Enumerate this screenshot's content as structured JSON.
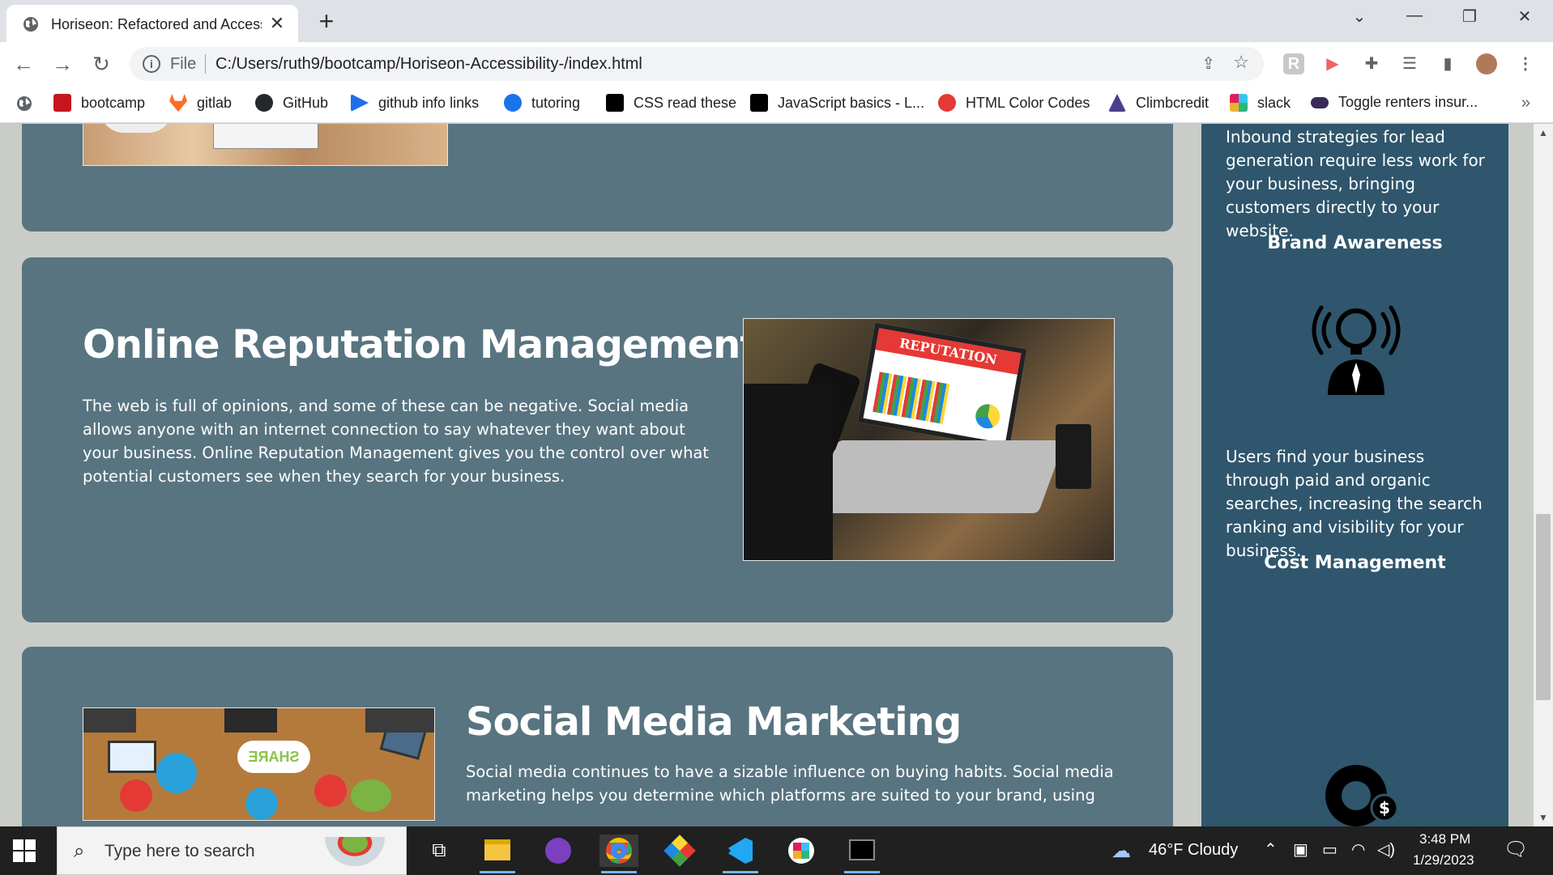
{
  "browser": {
    "tab_title": "Horiseon: Refactored and Accessible",
    "url_scheme": "File",
    "url": "C:/Users/ruth9/bootcamp/Horiseon-Accessibility-/index.html",
    "bookmarks": [
      {
        "label": "bootcamp",
        "color": "#c4161c"
      },
      {
        "label": "gitlab",
        "color": "#fc6d26"
      },
      {
        "label": "GitHub",
        "color": "#24292e"
      },
      {
        "label": "github info links",
        "color": "#1f6feb"
      },
      {
        "label": "tutoring",
        "color": "#1a73e8"
      },
      {
        "label": "CSS read these",
        "color": "#000000"
      },
      {
        "label": "JavaScript basics - L...",
        "color": "#000000"
      },
      {
        "label": "HTML Color Codes",
        "color": "#e53935"
      },
      {
        "label": "Climbcredit",
        "color": "#4a3f8a"
      },
      {
        "label": "slack",
        "color": "#36c5f0"
      },
      {
        "label": "Toggle renters insur...",
        "color": "#3a2a5a"
      }
    ]
  },
  "page": {
    "top_card_image_alt": "notebook on wooden desk",
    "reputation": {
      "heading": "Online Reputation Management",
      "body": "The web is full of opinions, and some of these can be negative. Social media allows anyone with an internet connection to say whatever they want about your business. Online Reputation Management gives you the control over what potential customers see when they search for your business.",
      "image_text": "REPUTATION"
    },
    "social": {
      "heading": "Social Media Marketing",
      "body": "Social media continues to have a sizable influence on buying habits. Social media marketing helps you determine which platforms are suited to your brand, using",
      "image_text": "SHARE"
    },
    "aside": {
      "lead_text": "Inbound strategies for lead generation require less work for your business, bringing customers directly to your website.",
      "brand_heading": "Brand Awareness",
      "brand_text": "Users find your business through paid and organic searches, increasing the search ranking and visibility for your business.",
      "cost_heading": "Cost Management"
    }
  },
  "taskbar": {
    "search_placeholder": "Type here to search",
    "weather": "46°F  Cloudy",
    "time": "3:48 PM",
    "date": "1/29/2023"
  },
  "colors": {
    "card": "#587480",
    "aside": "#2f566c",
    "page_bg": "#c9ccc7"
  }
}
